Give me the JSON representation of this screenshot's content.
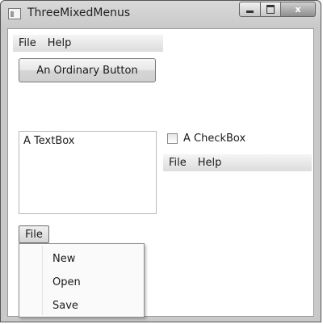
{
  "window": {
    "title": "ThreeMixedMenus",
    "icon": "window-app-icon",
    "caption_buttons": {
      "minimize": "minimize-icon",
      "maximize": "maximize-icon",
      "close_label": "x"
    }
  },
  "top_menu": {
    "items": [
      {
        "label": "File"
      },
      {
        "label": "Help"
      }
    ]
  },
  "ordinary_button": {
    "label": "An Ordinary Button"
  },
  "textbox": {
    "value": "A TextBox"
  },
  "checkbox": {
    "label": "A CheckBox",
    "checked": false
  },
  "side_menu": {
    "items": [
      {
        "label": "File"
      },
      {
        "label": "Help"
      }
    ]
  },
  "file_button": {
    "label": "File"
  },
  "file_popup": {
    "items": [
      {
        "label": "New"
      },
      {
        "label": "Open"
      },
      {
        "label": "Save"
      }
    ]
  },
  "colors": {
    "chrome": "#c9c9c9",
    "client_bg": "#ffffff",
    "menubar": "#dcdcdc",
    "border": "#7a7a7a"
  }
}
